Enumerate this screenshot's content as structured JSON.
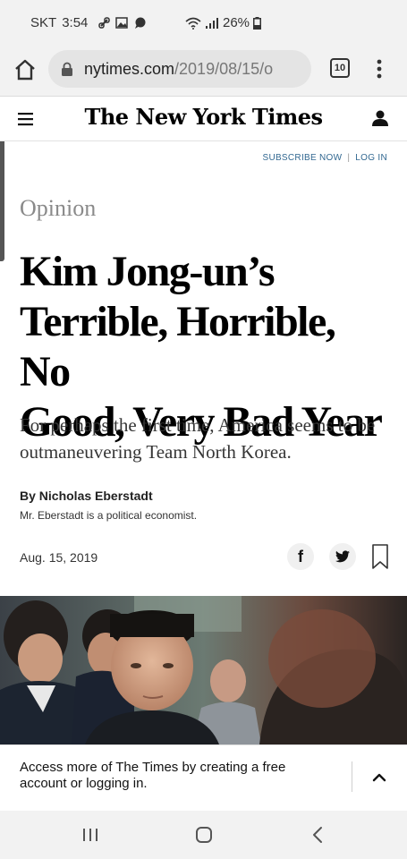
{
  "status_bar": {
    "carrier": "SKT",
    "time": "3:54",
    "battery": "26%"
  },
  "browser": {
    "url_host": "nytimes.com",
    "url_path": "/2019/08/15/o",
    "tab_count": "10"
  },
  "nyt": {
    "masthead": "The New York Times",
    "subscribe": "SUBSCRIBE NOW",
    "separator": "|",
    "login": "LOG IN"
  },
  "article": {
    "kicker": "Opinion",
    "headline_lines": [
      "Kim Jong-un’s",
      "Terrible, Horrible, No",
      "Good, Very Bad Year"
    ],
    "summary": "For perhaps the first time, America seems to be outmaneuvering Team North Korea.",
    "byline": "By Nicholas Eberstadt",
    "bio": "Mr. Eberstadt is a political economist.",
    "date": "Aug. 15, 2019"
  },
  "share": {
    "facebook_glyph": "f"
  },
  "banner": {
    "text": "Access more of The Times by creating a free account or logging in."
  },
  "icons": [
    "home-icon",
    "lock-icon",
    "tabs-icon",
    "more-vert-icon",
    "hamburger-icon",
    "account-icon",
    "facebook-icon",
    "twitter-icon",
    "bookmark-icon",
    "chevron-up-icon",
    "recents-icon",
    "nav-home-icon",
    "back-icon"
  ],
  "colors": {
    "link_blue": "#326891",
    "kicker_gray": "#8a8a8a",
    "chrome_bg": "#f2f2f2"
  }
}
